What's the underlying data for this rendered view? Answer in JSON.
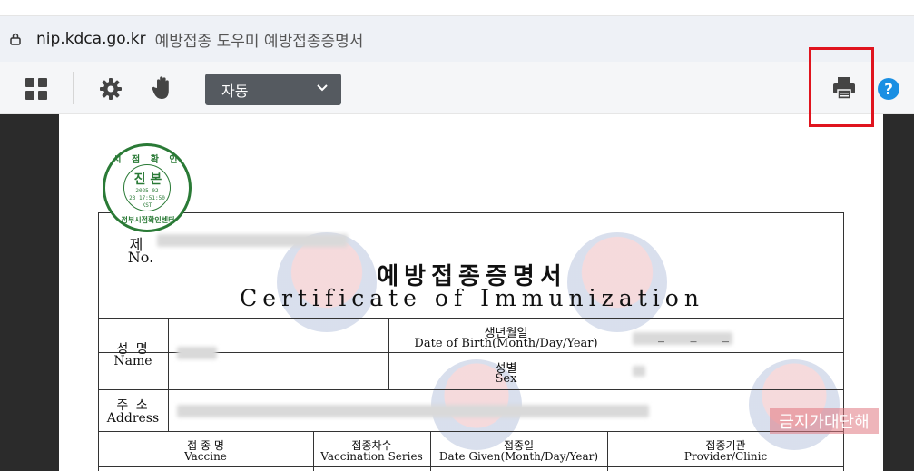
{
  "address_bar": {
    "host": "nip.kdca.go.kr",
    "page_title": "예방접종 도우미 예방접종증명서"
  },
  "toolbar": {
    "zoom_value": "자동",
    "icons": [
      "grid-icon",
      "gear-icon",
      "hand-icon",
      "printer-icon",
      "help-icon"
    ]
  },
  "stamp": {
    "ring_top": "시 점 확 인",
    "main": "진 본",
    "date_line1": "2025-02",
    "date_line2": "23  17:51:50",
    "date_line3": "KST",
    "ring_bottom": "정부시점확인센터"
  },
  "certificate": {
    "no_label_ko": "제",
    "no_label_en": "No.",
    "title_ko": "예방접종증명서",
    "title_en": "Certificate of Immunization",
    "name_label_ko": "성   명",
    "name_label_en": "Name",
    "dob_label_ko": "생년월일",
    "dob_label_en": "Date of Birth(Month/Day/Year)",
    "dob_value": "_ _ _",
    "sex_label_ko": "성별",
    "sex_label_en": "Sex",
    "address_label_ko": "주   소",
    "address_label_en": "Address",
    "col_vaccine_ko": "접 종 명",
    "col_vaccine_en": "Vaccine",
    "col_series_ko": "접종차수",
    "col_series_en": "Vaccination Series",
    "col_date_ko": "접종일",
    "col_date_en": "Date Given(Month/Day/Year)",
    "col_provider_ko": "접종기관",
    "col_provider_en": "Provider/Clinic"
  },
  "watermark_banner": "금지가대단해",
  "colors": {
    "highlight": "#e0141e",
    "help_blue": "#1a8fe3",
    "stamp_green": "#2a7a36"
  }
}
